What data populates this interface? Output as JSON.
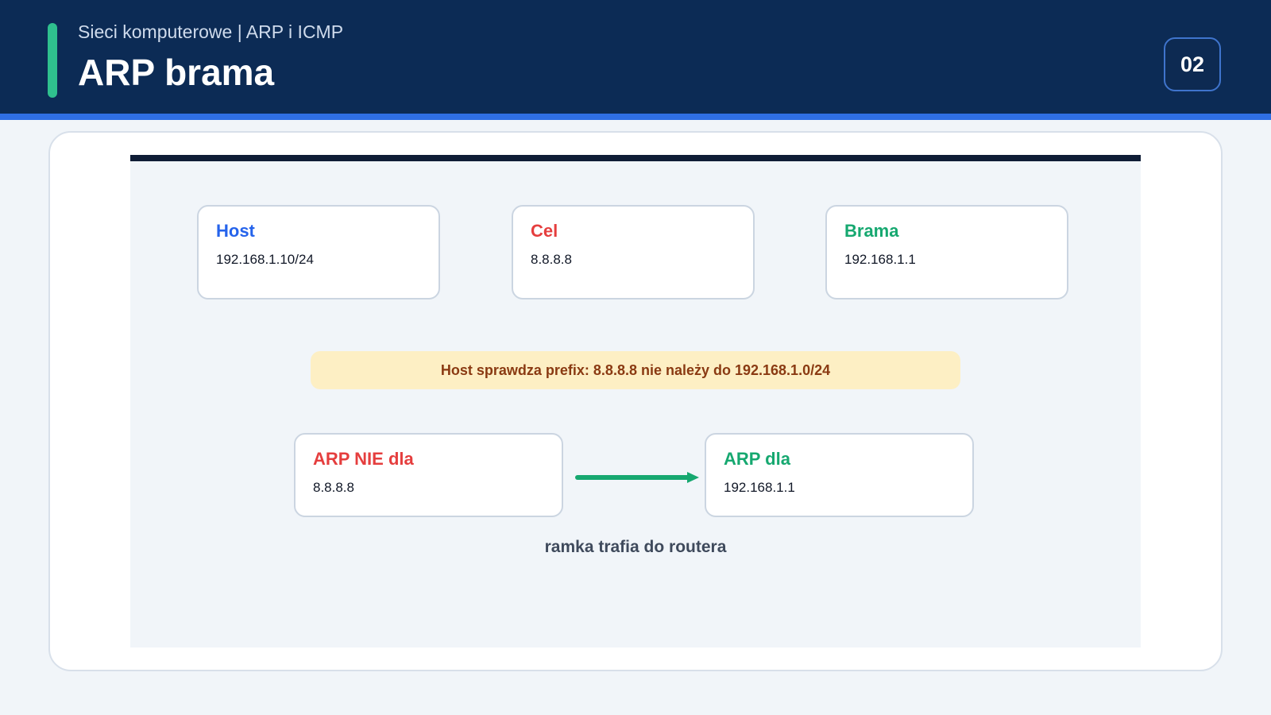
{
  "header": {
    "subtitle": "Sieci komputerowe | ARP i ICMP",
    "title": "ARP brama",
    "page_number": "02",
    "colors": {
      "background": "#0c2b55",
      "accent": "#2fc08e",
      "underline": "#2f6fe4"
    }
  },
  "diagram": {
    "nodes": [
      {
        "id": "host",
        "title": "Host",
        "value": "192.168.1.10/24",
        "color": "#2563eb"
      },
      {
        "id": "target",
        "title": "Cel",
        "value": "8.8.8.8",
        "color": "#e53e3e"
      },
      {
        "id": "gateway",
        "title": "Brama",
        "value": "192.168.1.1",
        "color": "#16a870"
      }
    ],
    "note": "Host sprawdza prefix: 8.8.8.8 nie należy do 192.168.1.0/24",
    "arp_not": {
      "title": "ARP NIE dla",
      "value": "8.8.8.8",
      "color": "#e53e3e"
    },
    "arp_for": {
      "title": "ARP dla",
      "value": "192.168.1.1",
      "color": "#16a870"
    },
    "arrow": {
      "icon": "arrow-right-icon",
      "color": "#16a870"
    },
    "caption": "ramka trafia do routera"
  }
}
